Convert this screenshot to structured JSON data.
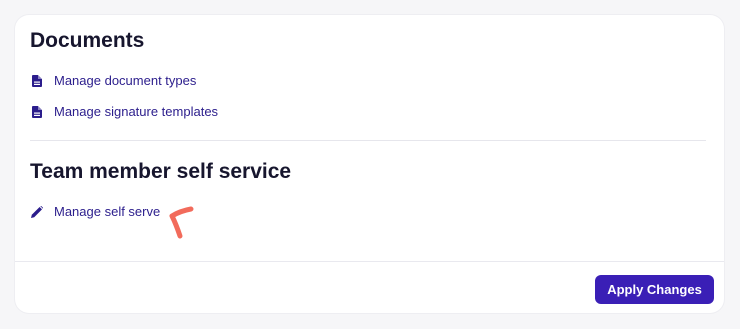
{
  "documents": {
    "title": "Documents",
    "links": [
      {
        "label": "Manage document types",
        "icon": "document-icon"
      },
      {
        "label": "Manage signature templates",
        "icon": "document-icon"
      }
    ]
  },
  "self_service": {
    "title": "Team member self service",
    "links": [
      {
        "label": "Manage self serve",
        "icon": "pencil-icon"
      }
    ]
  },
  "footer": {
    "apply_label": "Apply Changes"
  },
  "colors": {
    "accent": "#3a1fb6",
    "link": "#2b1d8c",
    "annotation": "#f26b5b"
  }
}
